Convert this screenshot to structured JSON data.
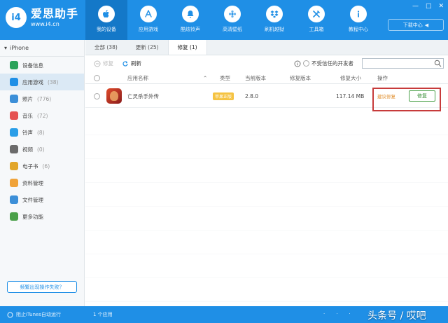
{
  "app": {
    "logo_badge": "i4",
    "logo_name": "爱思助手",
    "logo_url": "www.i4.cn"
  },
  "nav": [
    {
      "label": "我的设备",
      "icon": "apple-icon"
    },
    {
      "label": "应用游戏",
      "icon": "app-store-icon"
    },
    {
      "label": "酷炫铃声",
      "icon": "bell-icon"
    },
    {
      "label": "高清壁纸",
      "icon": "flower-icon"
    },
    {
      "label": "刷机越狱",
      "icon": "dropbox-icon"
    },
    {
      "label": "工具箱",
      "icon": "tools-icon"
    },
    {
      "label": "教程中心",
      "icon": "info-icon"
    }
  ],
  "window_controls": {
    "minimize": "—",
    "maximize": "□",
    "close": "✕"
  },
  "download_center": {
    "label": "下载中心",
    "arrow": "◀"
  },
  "sidebar": {
    "device_name": "iPhone",
    "items": [
      {
        "label": "设备信息",
        "count": "",
        "icon": "info-icon",
        "color": "#2aa35a"
      },
      {
        "label": "应用游戏",
        "count": "(38)",
        "icon": "apps-icon",
        "color": "#1f8fe6"
      },
      {
        "label": "照片",
        "count": "(776)",
        "icon": "photo-icon",
        "color": "#3c8fd8"
      },
      {
        "label": "音乐",
        "count": "(72)",
        "icon": "music-icon",
        "color": "#e55252"
      },
      {
        "label": "铃声",
        "count": "(8)",
        "icon": "bell-icon",
        "color": "#2a9ee8"
      },
      {
        "label": "视频",
        "count": "(0)",
        "icon": "video-icon",
        "color": "#6b6b6b"
      },
      {
        "label": "电子书",
        "count": "(6)",
        "icon": "book-icon",
        "color": "#e2a62a"
      },
      {
        "label": "资料管理",
        "count": "",
        "icon": "contacts-icon",
        "color": "#f0a33a"
      },
      {
        "label": "文件管理",
        "count": "",
        "icon": "folder-icon",
        "color": "#3c8fd8"
      },
      {
        "label": "更多功能",
        "count": "",
        "icon": "more-icon",
        "color": "#4aa049"
      }
    ],
    "help_button": "频繁出现操作失败？"
  },
  "tabs": [
    {
      "label": "全部 (38)"
    },
    {
      "label": "更新 (25)"
    },
    {
      "label": "修复 (1)"
    }
  ],
  "toolbar": {
    "repair_all": "修复",
    "refresh": "刷新",
    "untrusted_dev": "不受信任的开发者",
    "search_placeholder": ""
  },
  "table": {
    "headers": [
      "应用名称",
      "类型",
      "当前版本",
      "修复版本",
      "修复大小",
      "操作"
    ],
    "rows": [
      {
        "name": "亡灵杀手外传",
        "type": "苹果正版",
        "current_version": "2.8.0",
        "repair_version": "",
        "size": "117.14 MB",
        "op_hint": "建议修复",
        "op_button": "修复"
      }
    ]
  },
  "statusbar": {
    "itunes_stop": "阻止iTunes自动运行",
    "count": "1 个应用",
    "watermark": "头条号 / 哎吧"
  }
}
